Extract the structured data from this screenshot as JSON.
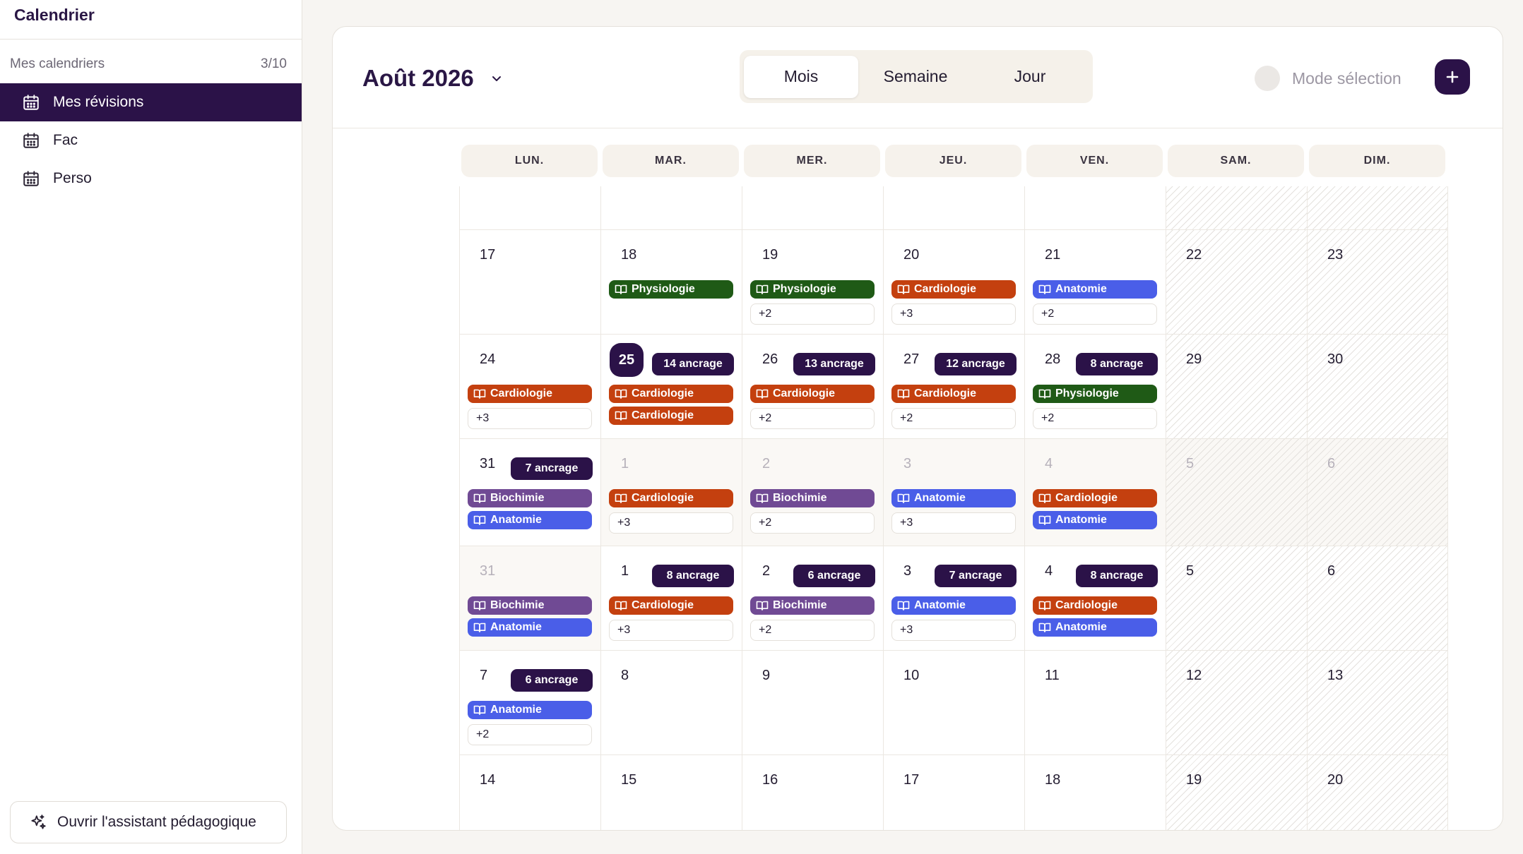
{
  "sidebar": {
    "app_title": "Calendrier",
    "section_label": "Mes calendriers",
    "section_count": "3/10",
    "items": [
      {
        "label": "Mes révisions",
        "icon": "calendar-icon",
        "active": true
      },
      {
        "label": "Fac",
        "icon": "calendar-icon",
        "active": false
      },
      {
        "label": "Perso",
        "icon": "calendar-icon",
        "active": false
      }
    ],
    "assistant_label": "Ouvrir l'assistant pédagogique",
    "assistant_icon": "sparkles-icon"
  },
  "header": {
    "month_label": "Août 2026",
    "views": [
      "Mois",
      "Semaine",
      "Jour"
    ],
    "active_view": "Mois",
    "mode_selection_label": "Mode sélection",
    "add_icon": "plus-icon"
  },
  "weekdays": [
    "LUN.",
    "MAR.",
    "MER.",
    "JEU.",
    "VEN.",
    "SAM.",
    "DIM."
  ],
  "subject_colors": {
    "Physiologie": "#1f5a16",
    "Cardiologie": "#c4400f",
    "Anatomie": "#4a5ee8",
    "Biochimie": "#704a94",
    "ancrage": "#2b1248"
  },
  "weeks": [
    {
      "days": [
        {
          "num": ""
        },
        {
          "num": ""
        },
        {
          "num": ""
        },
        {
          "num": ""
        },
        {
          "num": ""
        },
        {
          "num": ""
        },
        {
          "num": ""
        }
      ]
    },
    {
      "days": [
        {
          "num": "17"
        },
        {
          "num": "18",
          "events": [
            "Physiologie"
          ]
        },
        {
          "num": "19",
          "events": [
            "Physiologie"
          ],
          "more": "+2"
        },
        {
          "num": "20",
          "events": [
            "Cardiologie"
          ],
          "more": "+3"
        },
        {
          "num": "21",
          "events": [
            "Anatomie"
          ],
          "more": "+2"
        },
        {
          "num": "22"
        },
        {
          "num": "23"
        }
      ]
    },
    {
      "days": [
        {
          "num": "24",
          "events": [
            "Cardiologie"
          ],
          "more": "+3"
        },
        {
          "num": "25",
          "today": true,
          "ancrage": "14 ancrage",
          "events": [
            "Cardiologie",
            "Cardiologie"
          ]
        },
        {
          "num": "26",
          "ancrage": "13 ancrage",
          "events": [
            "Cardiologie"
          ],
          "more": "+2"
        },
        {
          "num": "27",
          "ancrage": "12 ancrage",
          "events": [
            "Cardiologie"
          ],
          "more": "+2"
        },
        {
          "num": "28",
          "ancrage": "8 ancrage",
          "events": [
            "Physiologie"
          ],
          "more": "+2"
        },
        {
          "num": "29"
        },
        {
          "num": "30"
        }
      ]
    },
    {
      "days": [
        {
          "num": "31",
          "ancrage": "7 ancrage",
          "events": [
            "Biochimie",
            "Anatomie"
          ]
        },
        {
          "num": "1",
          "dim": true,
          "events": [
            "Cardiologie"
          ],
          "more": "+3"
        },
        {
          "num": "2",
          "dim": true,
          "events": [
            "Biochimie"
          ],
          "more": "+2"
        },
        {
          "num": "3",
          "dim": true,
          "events": [
            "Anatomie"
          ],
          "more": "+3"
        },
        {
          "num": "4",
          "dim": true,
          "events": [
            "Cardiologie",
            "Anatomie"
          ]
        },
        {
          "num": "5",
          "dim": true
        },
        {
          "num": "6",
          "dim": true
        }
      ]
    },
    {
      "days": [
        {
          "num": "31",
          "dim": true,
          "events": [
            "Biochimie",
            "Anatomie"
          ]
        },
        {
          "num": "1",
          "ancrage": "8 ancrage",
          "events": [
            "Cardiologie"
          ],
          "more": "+3"
        },
        {
          "num": "2",
          "ancrage": "6 ancrage",
          "events": [
            "Biochimie"
          ],
          "more": "+2"
        },
        {
          "num": "3",
          "ancrage": "7 ancrage",
          "events": [
            "Anatomie"
          ],
          "more": "+3"
        },
        {
          "num": "4",
          "ancrage": "8 ancrage",
          "events": [
            "Cardiologie",
            "Anatomie"
          ]
        },
        {
          "num": "5"
        },
        {
          "num": "6"
        }
      ]
    },
    {
      "days": [
        {
          "num": "7",
          "ancrage": "6 ancrage",
          "events": [
            "Anatomie"
          ],
          "more": "+2"
        },
        {
          "num": "8"
        },
        {
          "num": "9"
        },
        {
          "num": "10"
        },
        {
          "num": "11"
        },
        {
          "num": "12"
        },
        {
          "num": "13"
        }
      ]
    },
    {
      "days": [
        {
          "num": "14"
        },
        {
          "num": "15"
        },
        {
          "num": "16"
        },
        {
          "num": "17"
        },
        {
          "num": "18"
        },
        {
          "num": "19"
        },
        {
          "num": "20"
        }
      ]
    }
  ]
}
